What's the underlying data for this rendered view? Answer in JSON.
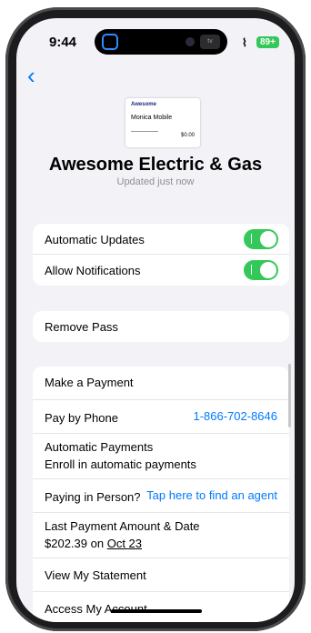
{
  "status": {
    "time": "9:44",
    "battery": "89+",
    "tv_label": "tv"
  },
  "pass": {
    "brand": "Awesome",
    "name": "Monica Mobile",
    "amount": "$0.00"
  },
  "header": {
    "title": "Awesome Electric & Gas",
    "subtitle": "Updated just now"
  },
  "settings": {
    "auto_updates": "Automatic Updates",
    "notifications": "Allow Notifications"
  },
  "remove": {
    "label": "Remove Pass"
  },
  "payments": {
    "make_payment": "Make a Payment",
    "pay_by_phone_label": "Pay by Phone",
    "pay_by_phone_number": "1-866-702-8646",
    "auto_payments_label": "Automatic Payments",
    "enroll_label": "Enroll in automatic payments",
    "in_person_label": "Paying in Person?",
    "in_person_link": "Tap here to find an agent",
    "last_payment_label": "Last Payment Amount & Date",
    "last_payment_amount": "$202.39 on",
    "last_payment_date": "Oct 23",
    "statement": "View My Statement",
    "account": "Access My Account"
  },
  "icons": {
    "back": "back-chevron-icon",
    "wifi": "wifi-icon",
    "battery": "battery-icon"
  }
}
